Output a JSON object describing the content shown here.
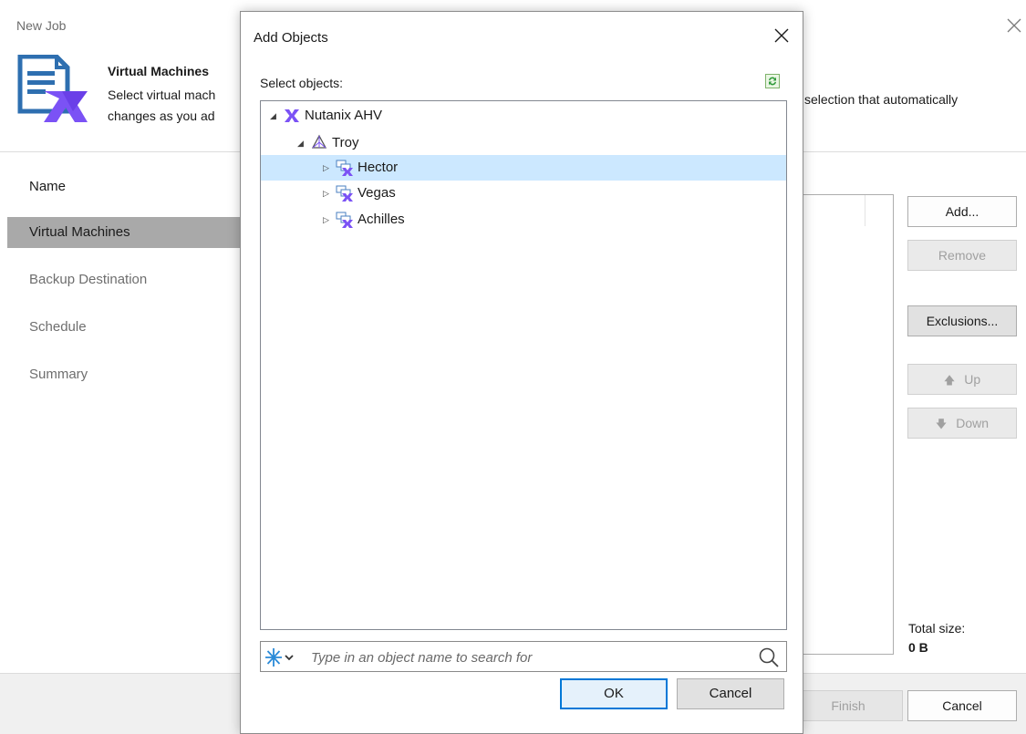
{
  "wizard": {
    "title": "New Job",
    "header": {
      "title": "Virtual Machines",
      "desc_line1": "Select virtual mach",
      "desc_line2": "changes as you ad",
      "desc_right": "selection that automatically"
    },
    "nav": [
      {
        "label": "Name",
        "state": "done"
      },
      {
        "label": "Virtual Machines",
        "state": "active"
      },
      {
        "label": "Backup Destination",
        "state": "pending"
      },
      {
        "label": "Schedule",
        "state": "pending"
      },
      {
        "label": "Summary",
        "state": "pending"
      }
    ],
    "buttons": {
      "add": "Add...",
      "remove": "Remove",
      "exclusions": "Exclusions...",
      "up": "Up",
      "down": "Down"
    },
    "total_size_label": "Total size:",
    "total_size_value": "0 B",
    "footer": {
      "finish": "Finish",
      "cancel": "Cancel"
    }
  },
  "dialog": {
    "title": "Add Objects",
    "select_label": "Select objects:",
    "tree": [
      {
        "label": "Nutanix AHV",
        "level": 0,
        "expanded": true,
        "icon": "nutanix-icon"
      },
      {
        "label": "Troy",
        "level": 1,
        "expanded": true,
        "icon": "cluster-icon"
      },
      {
        "label": "Hector",
        "level": 2,
        "expanded": false,
        "icon": "vm-group-icon",
        "selected": true
      },
      {
        "label": "Vegas",
        "level": 2,
        "expanded": false,
        "icon": "vm-group-icon"
      },
      {
        "label": "Achilles",
        "level": 2,
        "expanded": false,
        "icon": "vm-group-icon"
      }
    ],
    "search_placeholder": "Type in an object name to search for",
    "ok": "OK",
    "cancel": "Cancel"
  },
  "colors": {
    "accent_purple": "#7b52f5",
    "selection": "#cce8ff",
    "active_nav": "#a9a9a9",
    "logo_blue": "#2e6fb0"
  }
}
